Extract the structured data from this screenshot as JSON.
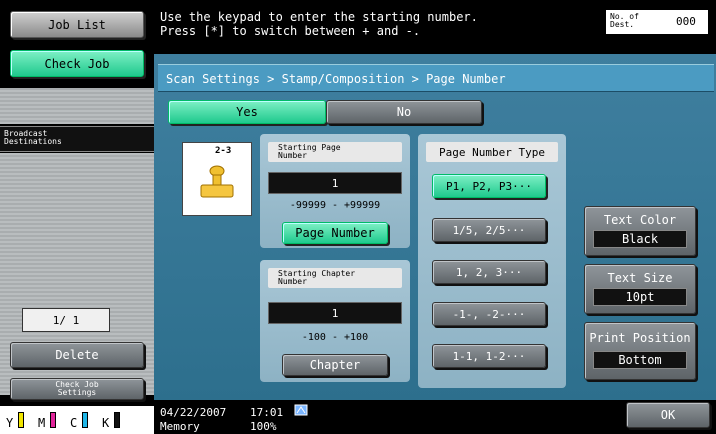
{
  "left": {
    "job_list": "Job List",
    "check_job": "Check Job",
    "broadcast": "Broadcast\nDestinations",
    "page_counter": "1/ 1",
    "delete": "Delete",
    "check_job_settings": "Check Job\nSettings",
    "toner": [
      "Y",
      "M",
      "C",
      "K"
    ]
  },
  "message": {
    "line1": "Use the keypad to enter the starting number.",
    "line2": "Press [*] to switch between + and -.",
    "dest_label": "No. of\nDest.",
    "dest_value": "000"
  },
  "breadcrumb": "Scan Settings > Stamp/Composition > Page Number",
  "toggle": {
    "yes": "Yes",
    "no": "No"
  },
  "preview_label": "2-3",
  "starting_page": {
    "label": "Starting Page\nNumber",
    "value": "1",
    "range": "-99999  -  +99999",
    "button": "Page Number"
  },
  "starting_chapter": {
    "label": "Starting Chapter\nNumber",
    "value": "1",
    "range": "-100  -  +100",
    "button": "Chapter"
  },
  "page_number_type": {
    "title": "Page Number Type",
    "options": [
      "P1, P2, P3···",
      "1/5, 2/5···",
      "1, 2, 3···",
      "-1-, -2-···",
      "1-1, 1-2···"
    ]
  },
  "text_color": {
    "label": "Text Color",
    "value": "Black"
  },
  "text_size": {
    "label": "Text Size",
    "value": "10pt"
  },
  "print_position": {
    "label": "Print Position",
    "value": "Bottom"
  },
  "ok": "OK",
  "status": {
    "date": "04/22/2007",
    "time": "17:01",
    "memory_label": "Memory",
    "memory_value": "100%"
  },
  "colors": {
    "toner_y": "#f2e600",
    "toner_m": "#e0249a",
    "toner_c": "#1fb6e8",
    "toner_k": "#111111"
  }
}
